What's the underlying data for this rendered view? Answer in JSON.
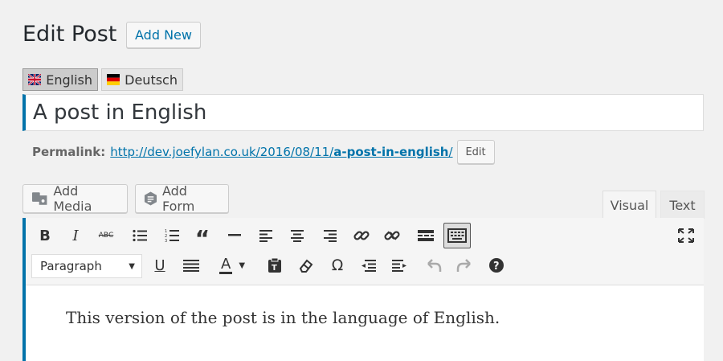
{
  "header": {
    "title": "Edit Post",
    "add_new": "Add New"
  },
  "languages": [
    {
      "label": "English",
      "flag": "uk-flag-icon",
      "active": true
    },
    {
      "label": "Deutsch",
      "flag": "de-flag-icon",
      "active": false
    }
  ],
  "post": {
    "title": "A post in English"
  },
  "permalink": {
    "label": "Permalink:",
    "url_base": "http://dev.joefylan.co.uk/2016/08/11/",
    "slug": "a-post-in-english",
    "url_end": "/",
    "edit": "Edit"
  },
  "media": {
    "add_media": "Add Media",
    "add_form": "Add Form"
  },
  "tabs": {
    "visual": "Visual",
    "text": "Text"
  },
  "editor": {
    "format": "Paragraph",
    "content": "This version of the post is in the language of English."
  },
  "colors": {
    "accent": "#0073aa",
    "background": "#f1f1f1"
  }
}
